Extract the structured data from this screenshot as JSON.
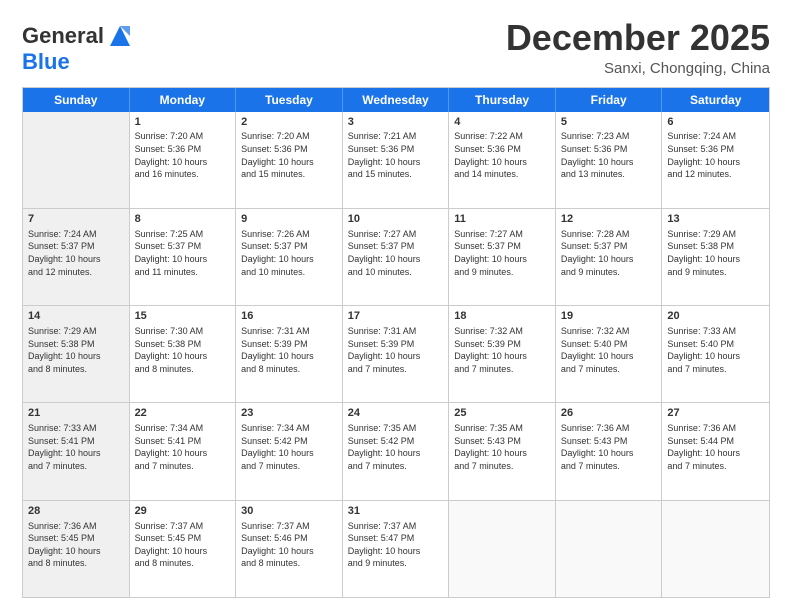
{
  "logo": {
    "line1": "General",
    "line2": "Blue"
  },
  "title": "December 2025",
  "subtitle": "Sanxi, Chongqing, China",
  "header_days": [
    "Sunday",
    "Monday",
    "Tuesday",
    "Wednesday",
    "Thursday",
    "Friday",
    "Saturday"
  ],
  "rows": [
    [
      {
        "day": "",
        "info": "",
        "shaded": true
      },
      {
        "day": "1",
        "info": "Sunrise: 7:20 AM\nSunset: 5:36 PM\nDaylight: 10 hours\nand 16 minutes."
      },
      {
        "day": "2",
        "info": "Sunrise: 7:20 AM\nSunset: 5:36 PM\nDaylight: 10 hours\nand 15 minutes."
      },
      {
        "day": "3",
        "info": "Sunrise: 7:21 AM\nSunset: 5:36 PM\nDaylight: 10 hours\nand 15 minutes."
      },
      {
        "day": "4",
        "info": "Sunrise: 7:22 AM\nSunset: 5:36 PM\nDaylight: 10 hours\nand 14 minutes."
      },
      {
        "day": "5",
        "info": "Sunrise: 7:23 AM\nSunset: 5:36 PM\nDaylight: 10 hours\nand 13 minutes."
      },
      {
        "day": "6",
        "info": "Sunrise: 7:24 AM\nSunset: 5:36 PM\nDaylight: 10 hours\nand 12 minutes."
      }
    ],
    [
      {
        "day": "7",
        "info": "Sunrise: 7:24 AM\nSunset: 5:37 PM\nDaylight: 10 hours\nand 12 minutes.",
        "shaded": true
      },
      {
        "day": "8",
        "info": "Sunrise: 7:25 AM\nSunset: 5:37 PM\nDaylight: 10 hours\nand 11 minutes."
      },
      {
        "day": "9",
        "info": "Sunrise: 7:26 AM\nSunset: 5:37 PM\nDaylight: 10 hours\nand 10 minutes."
      },
      {
        "day": "10",
        "info": "Sunrise: 7:27 AM\nSunset: 5:37 PM\nDaylight: 10 hours\nand 10 minutes."
      },
      {
        "day": "11",
        "info": "Sunrise: 7:27 AM\nSunset: 5:37 PM\nDaylight: 10 hours\nand 9 minutes."
      },
      {
        "day": "12",
        "info": "Sunrise: 7:28 AM\nSunset: 5:37 PM\nDaylight: 10 hours\nand 9 minutes."
      },
      {
        "day": "13",
        "info": "Sunrise: 7:29 AM\nSunset: 5:38 PM\nDaylight: 10 hours\nand 9 minutes."
      }
    ],
    [
      {
        "day": "14",
        "info": "Sunrise: 7:29 AM\nSunset: 5:38 PM\nDaylight: 10 hours\nand 8 minutes.",
        "shaded": true
      },
      {
        "day": "15",
        "info": "Sunrise: 7:30 AM\nSunset: 5:38 PM\nDaylight: 10 hours\nand 8 minutes."
      },
      {
        "day": "16",
        "info": "Sunrise: 7:31 AM\nSunset: 5:39 PM\nDaylight: 10 hours\nand 8 minutes."
      },
      {
        "day": "17",
        "info": "Sunrise: 7:31 AM\nSunset: 5:39 PM\nDaylight: 10 hours\nand 7 minutes."
      },
      {
        "day": "18",
        "info": "Sunrise: 7:32 AM\nSunset: 5:39 PM\nDaylight: 10 hours\nand 7 minutes."
      },
      {
        "day": "19",
        "info": "Sunrise: 7:32 AM\nSunset: 5:40 PM\nDaylight: 10 hours\nand 7 minutes."
      },
      {
        "day": "20",
        "info": "Sunrise: 7:33 AM\nSunset: 5:40 PM\nDaylight: 10 hours\nand 7 minutes."
      }
    ],
    [
      {
        "day": "21",
        "info": "Sunrise: 7:33 AM\nSunset: 5:41 PM\nDaylight: 10 hours\nand 7 minutes.",
        "shaded": true
      },
      {
        "day": "22",
        "info": "Sunrise: 7:34 AM\nSunset: 5:41 PM\nDaylight: 10 hours\nand 7 minutes."
      },
      {
        "day": "23",
        "info": "Sunrise: 7:34 AM\nSunset: 5:42 PM\nDaylight: 10 hours\nand 7 minutes."
      },
      {
        "day": "24",
        "info": "Sunrise: 7:35 AM\nSunset: 5:42 PM\nDaylight: 10 hours\nand 7 minutes."
      },
      {
        "day": "25",
        "info": "Sunrise: 7:35 AM\nSunset: 5:43 PM\nDaylight: 10 hours\nand 7 minutes."
      },
      {
        "day": "26",
        "info": "Sunrise: 7:36 AM\nSunset: 5:43 PM\nDaylight: 10 hours\nand 7 minutes."
      },
      {
        "day": "27",
        "info": "Sunrise: 7:36 AM\nSunset: 5:44 PM\nDaylight: 10 hours\nand 7 minutes."
      }
    ],
    [
      {
        "day": "28",
        "info": "Sunrise: 7:36 AM\nSunset: 5:45 PM\nDaylight: 10 hours\nand 8 minutes.",
        "shaded": true
      },
      {
        "day": "29",
        "info": "Sunrise: 7:37 AM\nSunset: 5:45 PM\nDaylight: 10 hours\nand 8 minutes."
      },
      {
        "day": "30",
        "info": "Sunrise: 7:37 AM\nSunset: 5:46 PM\nDaylight: 10 hours\nand 8 minutes."
      },
      {
        "day": "31",
        "info": "Sunrise: 7:37 AM\nSunset: 5:47 PM\nDaylight: 10 hours\nand 9 minutes."
      },
      {
        "day": "",
        "info": "",
        "shaded": false
      },
      {
        "day": "",
        "info": "",
        "shaded": false
      },
      {
        "day": "",
        "info": "",
        "shaded": false
      }
    ]
  ]
}
